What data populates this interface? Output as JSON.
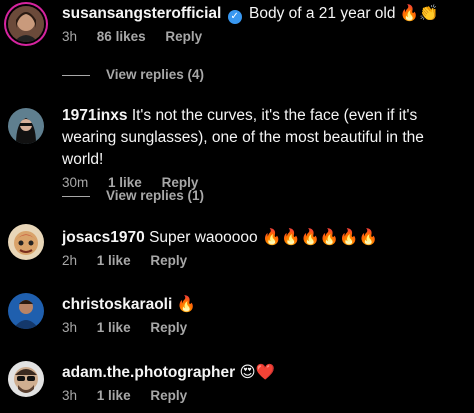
{
  "comments": [
    {
      "username": "susansangsterofficial",
      "verified": true,
      "text": "Body of a 21 year old 🔥👏",
      "time": "3h",
      "likes": "86 likes",
      "reply": "Reply",
      "view_replies": "View replies (4)",
      "avatar_icon": "profile-photo-woman"
    },
    {
      "username": "1971inxs",
      "verified": false,
      "text": "It's not the curves, it's the face (even if it's wearing sunglasses), one of the most beautiful in the world!",
      "time": "30m",
      "likes": "1 like",
      "reply": "Reply",
      "view_replies": "View replies (1)",
      "avatar_icon": "profile-photo-woman-dark-hair"
    },
    {
      "username": "josacs1970",
      "verified": false,
      "text": "Super waooooo 🔥🔥🔥🔥🔥🔥",
      "time": "2h",
      "likes": "1 like",
      "reply": "Reply",
      "avatar_icon": "profile-illustration-luchador"
    },
    {
      "username": "christoskaraoli",
      "verified": false,
      "text": "🔥",
      "time": "3h",
      "likes": "1 like",
      "reply": "Reply",
      "avatar_icon": "profile-photo-man-blue"
    },
    {
      "username": "adam.the.photographer",
      "verified": false,
      "text": "😍❤️",
      "time": "3h",
      "likes": "1 like",
      "reply": "Reply",
      "avatar_icon": "profile-illustration-man-sunglasses"
    }
  ],
  "colors": {
    "background": "#000000",
    "text": "#f5f5f5",
    "muted": "#a8a8a8",
    "verified": "#3897f0"
  }
}
